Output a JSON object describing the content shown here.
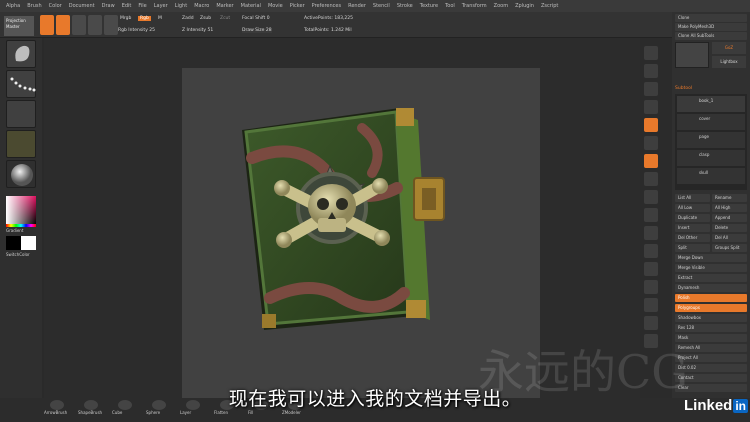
{
  "menubar": [
    "Alpha",
    "Brush",
    "Color",
    "Document",
    "Draw",
    "Edit",
    "File",
    "Layer",
    "Light",
    "Macro",
    "Marker",
    "Material",
    "Movie",
    "Picker",
    "Preferences",
    "Render",
    "Stencil",
    "Stroke",
    "Texture",
    "Tool",
    "Transform",
    "Zoom",
    "Zplugin",
    "Zscript"
  ],
  "toolbar": {
    "projection_label": "Projection Master",
    "mrgb": "Mrgb",
    "rgb": "Rgb",
    "m": "M",
    "zadd": "Zadd",
    "zsub": "Zsub",
    "zcut": "Zcut",
    "focal_shift": "Focal Shift 0",
    "active_points": "ActivePoints: 183,225",
    "rgb_intensity": "Rgb Intensity 25",
    "z_intensity": "Z Intensity 51",
    "draw_size": "Draw Size 28",
    "total_points": "TotalPoints: 1.242 Mil"
  },
  "left_panel": {
    "gradient_label": "Gradient",
    "switch_color_label": "SwitchColor"
  },
  "right_panel": {
    "top_buttons": [
      "Clone",
      "Make PolyMesh3D",
      "Clone All SubTools"
    ],
    "goz": "GoZ",
    "lightbox": "Lightbox",
    "subtool_header": "Subtool",
    "subtools": [
      "book_1",
      "cover",
      "page",
      "clasp",
      "skull"
    ],
    "rows": [
      "List All",
      "Rename",
      "All Low",
      "All High",
      "Duplicate",
      "Append",
      "Insert",
      "Delete",
      "Del Other",
      "Del All",
      "Split",
      "Groups Split",
      "Merge Down",
      "Merge Visible",
      "Extract",
      "Dynamesh",
      "Polish",
      "Polygroups",
      "Shadowbox",
      "Res 128",
      "Mask",
      "Remesh All",
      "Project All",
      "Dist 0.02",
      "Contact",
      "Clear"
    ]
  },
  "bottombar": [
    "ArrowBrush",
    "ShapeBrush",
    "Cube",
    "Sphere",
    "Layer",
    "Flatten",
    "Fill",
    "ZModeler"
  ],
  "subtitle": "现在我可以进入我的文档并导出。",
  "watermark": "永远的CG",
  "logo": "Linked",
  "logo_in": "in",
  "colors": {
    "accent": "#e8792b",
    "background": "#2a2a2a",
    "viewport": "#414141"
  }
}
